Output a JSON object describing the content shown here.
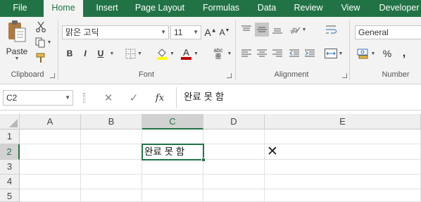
{
  "tabs": [
    {
      "label": "File",
      "active": false
    },
    {
      "label": "Home",
      "active": true
    },
    {
      "label": "Insert",
      "active": false
    },
    {
      "label": "Page Layout",
      "active": false
    },
    {
      "label": "Formulas",
      "active": false
    },
    {
      "label": "Data",
      "active": false
    },
    {
      "label": "Review",
      "active": false
    },
    {
      "label": "View",
      "active": false
    },
    {
      "label": "Developer",
      "active": false
    }
  ],
  "ribbon": {
    "clipboard": {
      "label": "Clipboard",
      "paste_label": "Paste"
    },
    "font": {
      "label": "Font",
      "font_name": "맑은 고딕",
      "font_size": "11",
      "bold": "B",
      "italic": "I",
      "underline": "U"
    },
    "alignment": {
      "label": "Alignment"
    },
    "number": {
      "label": "Number",
      "format": "General",
      "percent": "%",
      "comma": ","
    }
  },
  "formula_bar": {
    "name_box": "C2",
    "cancel": "✕",
    "enter": "✓",
    "fx": "fx",
    "content": "완료 못 함"
  },
  "grid": {
    "columns": [
      "A",
      "B",
      "C",
      "D",
      "E"
    ],
    "rows": [
      "1",
      "2",
      "3",
      "4",
      "5"
    ],
    "selected_column": "C",
    "selected_row": "2",
    "cells": {
      "C2": "완료 못 함",
      "D2": "✕"
    }
  },
  "colors": {
    "accent": "#217346",
    "font_color": "#c00000",
    "fill_color": "#ffff00"
  }
}
